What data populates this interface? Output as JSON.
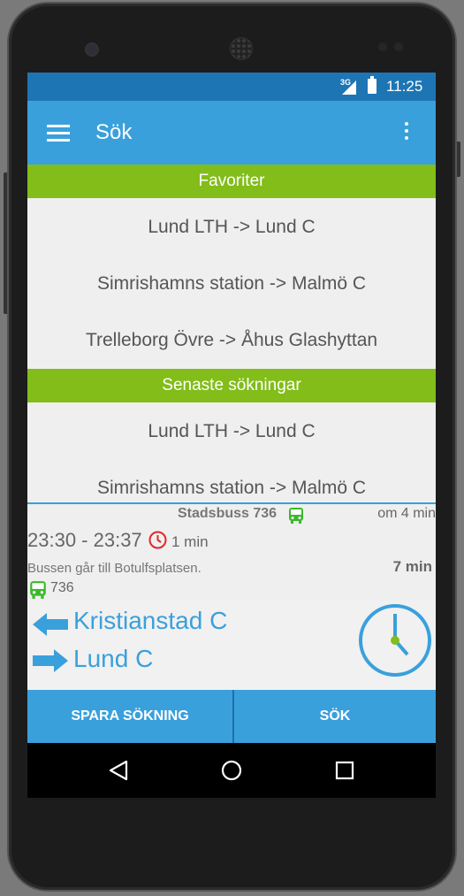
{
  "status_bar": {
    "network": "3G",
    "time": "11:25"
  },
  "app_bar": {
    "title": "Sök",
    "menu_icon": "hamburger-icon",
    "overflow_icon": "more-vert-icon"
  },
  "favorites": {
    "header": "Favoriter",
    "items": [
      "Lund LTH -> Lund C",
      "Simrishamns station -> Malmö C",
      "Trelleborg Övre -> Åhus Glashyttan"
    ]
  },
  "recent": {
    "header": "Senaste sökningar",
    "items": [
      "Lund LTH -> Lund C",
      "Simrishamns station -> Malmö C"
    ]
  },
  "trip": {
    "line_name": "Stadsbuss 736",
    "departs_in": "om 4 min",
    "times": "23:30 - 23:37",
    "delay": "1 min",
    "destination": "Bussen går till Botulfsplatsen.",
    "duration": "7 min",
    "line_number": "736"
  },
  "route": {
    "from": "Kristianstad C",
    "to": "Lund C"
  },
  "buttons": {
    "save": "SPARA SÖKNING",
    "search": "SÖK"
  },
  "colors": {
    "primary": "#3aa0dc",
    "status": "#1e75b4",
    "accent_green": "#82bd1a",
    "bus_green": "#3cb82a",
    "delay_red": "#e0262a"
  }
}
